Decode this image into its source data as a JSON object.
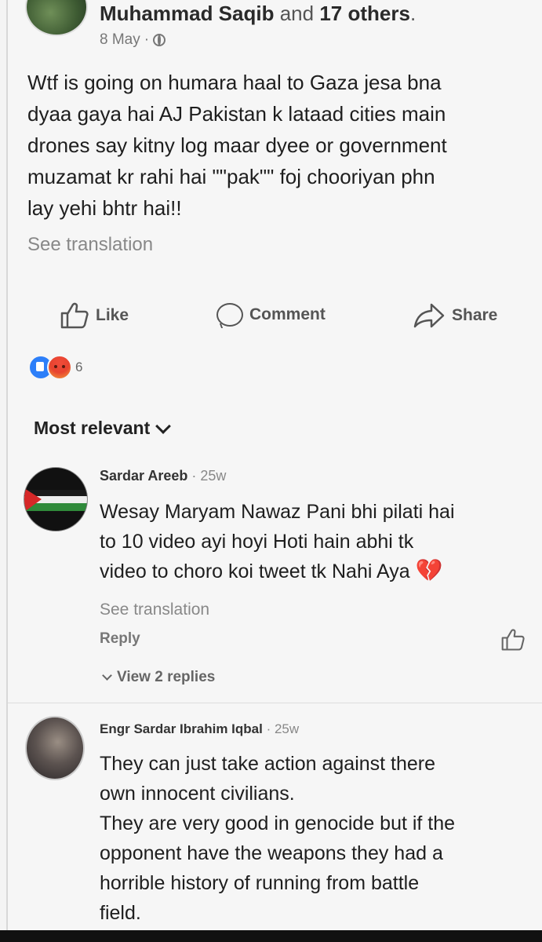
{
  "post": {
    "author": "Muhammad Saqib",
    "and_text": "and",
    "others": "17 others",
    "date": "8 May",
    "sep": "·",
    "body_lines": [
      "Wtf is going on humara haal to Gaza jesa bna",
      "dyaa gaya hai AJ Pakistan k lataad cities main",
      "drones say kitny log maar dyee or government",
      "muzamat kr rahi hai \"\"pak\"\" foj chooriyan phn",
      "lay yehi bhtr hai!!"
    ],
    "see_translation": "See translation",
    "actions": {
      "like": "Like",
      "comment": "Comment",
      "share": "Share"
    },
    "reactions": {
      "types": [
        "like",
        "angry"
      ],
      "count": "6"
    }
  },
  "comments_header": {
    "sort_label": "Most relevant"
  },
  "comments": [
    {
      "name": "Sardar Areeb",
      "time": "· 25w",
      "lines": [
        "Wesay Maryam Nawaz Pani bhi pilati hai",
        "to 10 video ayi hoyi Hoti hain abhi tk",
        "video to choro koi tweet tk Nahi Aya"
      ],
      "emoji": "💔",
      "see_translation": "See translation",
      "reply": "Reply",
      "view_replies": "View 2 replies"
    },
    {
      "name": "Engr Sardar Ibrahim Iqbal",
      "time": "· 25w",
      "lines": [
        "They can just take action against there",
        "own innocent civilians.",
        "They are very good in genocide but if the",
        "opponent have the weapons they had a",
        "horrible history of running from battle",
        "field."
      ]
    }
  ],
  "colors": {
    "background": "#f6f6f6",
    "text": "#1e1e1e",
    "muted": "#888888",
    "like_blue": "#2d7ff9",
    "angry_red": "#e8432f",
    "heart_red": "#e02838"
  }
}
